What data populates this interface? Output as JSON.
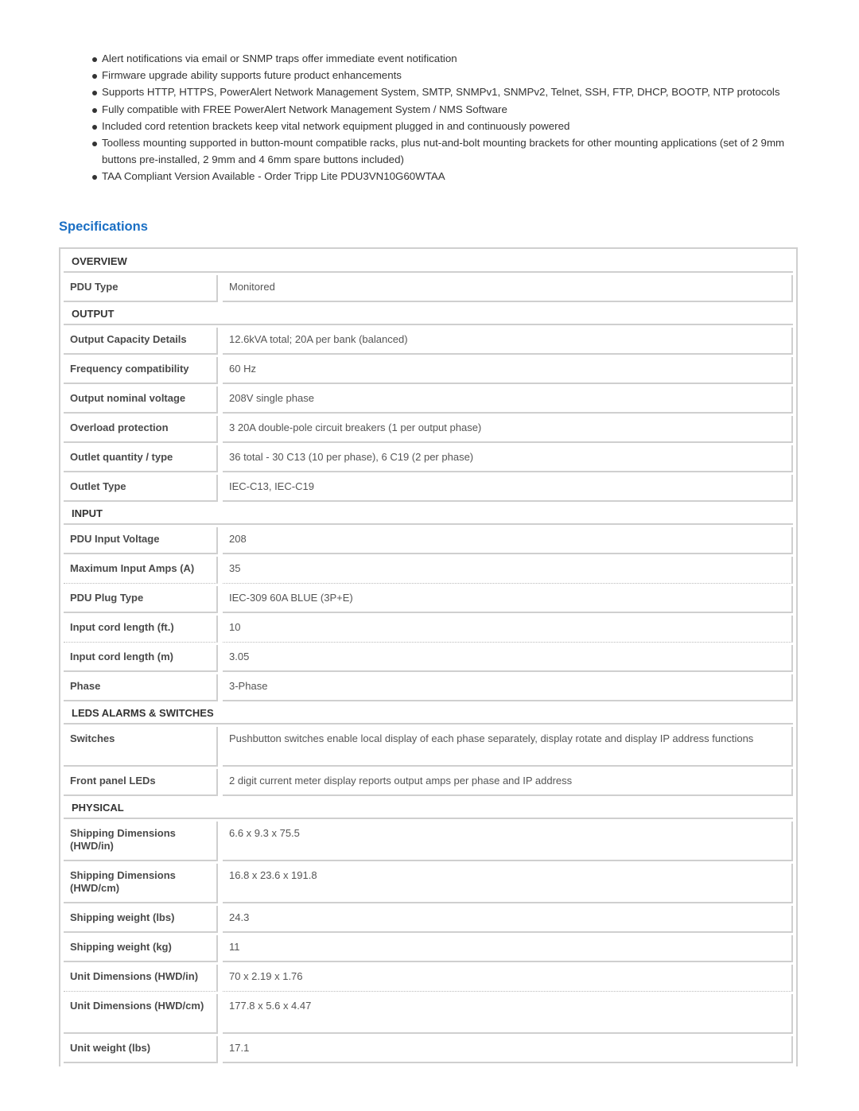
{
  "features": [
    "Alert notifications via email or SNMP traps offer immediate event notification",
    "Firmware upgrade ability supports future product enhancements",
    "Supports HTTP, HTTPS, PowerAlert Network Management System, SMTP, SNMPv1, SNMPv2, Telnet, SSH, FTP, DHCP, BOOTP, NTP protocols",
    "Fully compatible with FREE PowerAlert Network Management System / NMS Software",
    "Included cord retention brackets keep vital network equipment plugged in and continuously powered",
    " Toolless mounting supported in button-mount compatible racks, plus nut-and-bolt mounting brackets for other mounting applications (set of 2 9mm buttons pre-installed, 2 9mm and 4 6mm spare buttons included)",
    "TAA Compliant Version Available - Order Tripp Lite PDU3VN10G60WTAA"
  ],
  "specifications": {
    "title": "Specifications",
    "sections": [
      {
        "heading": "OVERVIEW",
        "rows": [
          {
            "label": "PDU Type",
            "value": "Monitored"
          }
        ]
      },
      {
        "heading": "OUTPUT",
        "rows": [
          {
            "label": "Output Capacity Details",
            "value": "12.6kVA total; 20A per bank (balanced)"
          },
          {
            "label": "Frequency compatibility",
            "value": "60 Hz"
          },
          {
            "label": "Output nominal voltage",
            "value": "208V single phase"
          },
          {
            "label": "Overload protection",
            "value": "3 20A double-pole circuit breakers (1 per output phase)"
          },
          {
            "label": "Outlet quantity / type",
            "value": "36 total - 30 C13 (10 per phase), 6 C19 (2 per phase)"
          },
          {
            "label": "Outlet Type",
            "value": "IEC-C13, IEC-C19"
          }
        ]
      },
      {
        "heading": "INPUT",
        "rows": [
          {
            "label": "PDU Input Voltage",
            "value": "208"
          },
          {
            "label": "Maximum Input Amps (A)",
            "value": "35"
          },
          {
            "label": "PDU Plug Type",
            "value": "IEC-309 60A BLUE (3P+E)"
          },
          {
            "label": "Input cord length (ft.)",
            "value": "10"
          },
          {
            "label": "Input cord length (m)",
            "value": "3.05"
          },
          {
            "label": "Phase",
            "value": "3-Phase"
          }
        ]
      },
      {
        "heading": "LEDS ALARMS & SWITCHES",
        "rows": [
          {
            "label": "Switches",
            "value": "Pushbutton switches enable local display of each phase separately, display rotate and display IP address functions"
          },
          {
            "label": "Front panel LEDs",
            "value": "2 digit current meter display reports output amps per phase and IP address"
          }
        ]
      },
      {
        "heading": "PHYSICAL",
        "rows": [
          {
            "label": "Shipping Dimensions (HWD/in)",
            "value": "6.6 x 9.3 x 75.5"
          },
          {
            "label": "Shipping Dimensions (HWD/cm)",
            "value": "16.8 x 23.6 x 191.8"
          },
          {
            "label": "Shipping weight (lbs)",
            "value": "24.3"
          },
          {
            "label": "Shipping weight (kg)",
            "value": "11"
          },
          {
            "label": "Unit Dimensions (HWD/in)",
            "value": "70 x 2.19 x 1.76"
          },
          {
            "label": "Unit Dimensions (HWD/cm)",
            "value": "177.8 x 5.6 x 4.47"
          },
          {
            "label": "Unit weight (lbs)",
            "value": "17.1"
          }
        ]
      }
    ]
  }
}
